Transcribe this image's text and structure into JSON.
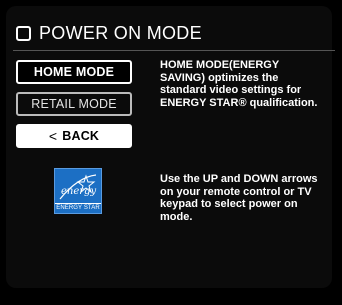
{
  "header": {
    "title": "POWER ON MODE",
    "icon": "checkbox-icon"
  },
  "menu": {
    "home_mode": "HOME MODE",
    "retail_mode": "RETAIL MODE",
    "back": "BACK",
    "back_icon": "<"
  },
  "info": {
    "description": "HOME MODE(ENERGY SAVING) optimizes the standard video settings for ENERGY STAR® qualification.",
    "instructions": "Use the UP and DOWN arrows on your remote control or TV keypad to select power on mode."
  },
  "logo": {
    "script": "energy",
    "label": "ENERGY STAR"
  },
  "colors": {
    "background": "#000000",
    "energy_star_blue": "#1c6fc4",
    "text": "#ffffff"
  }
}
